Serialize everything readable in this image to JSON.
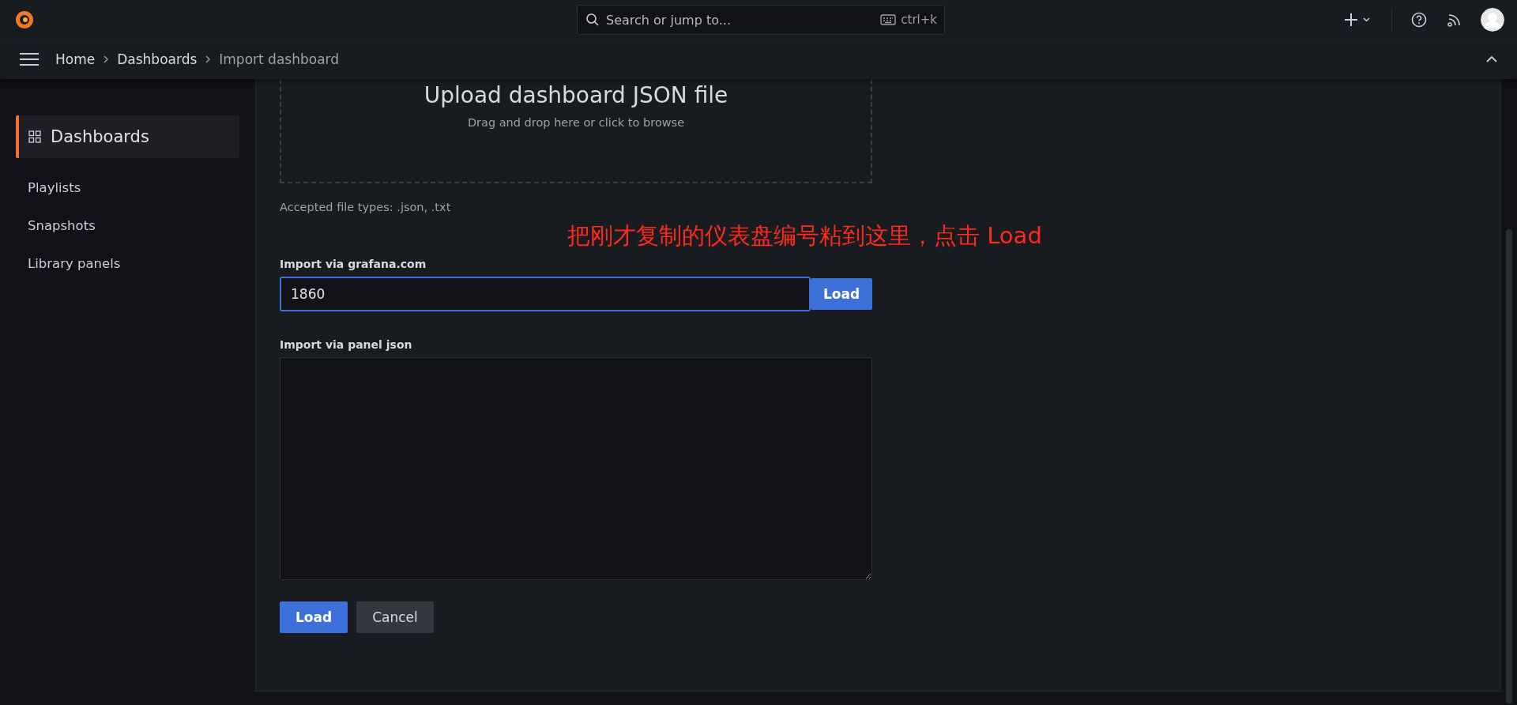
{
  "top_bar": {
    "search": {
      "placeholder": "Search or jump to...",
      "shortcut": "ctrl+k"
    }
  },
  "breadcrumbs": [
    {
      "label": "Home",
      "current": false
    },
    {
      "label": "Dashboards",
      "current": false
    },
    {
      "label": "Import dashboard",
      "current": true
    }
  ],
  "sidebar": {
    "section": "Dashboards",
    "items": [
      "Playlists",
      "Snapshots",
      "Library panels"
    ]
  },
  "upload": {
    "title": "Upload dashboard JSON file",
    "hint": "Drag and drop here or click to browse"
  },
  "accepted_types": "Accepted file types: .json, .txt",
  "annotation": "把刚才复制的仪表盘编号粘到这里，点击 Load",
  "grafana_import": {
    "label": "Import via grafana.com",
    "value": "1860",
    "button": "Load"
  },
  "json_import": {
    "label": "Import via panel json"
  },
  "buttons": [
    {
      "label": "Load",
      "kind": "primary"
    },
    {
      "label": "Cancel",
      "kind": "secondary"
    }
  ]
}
